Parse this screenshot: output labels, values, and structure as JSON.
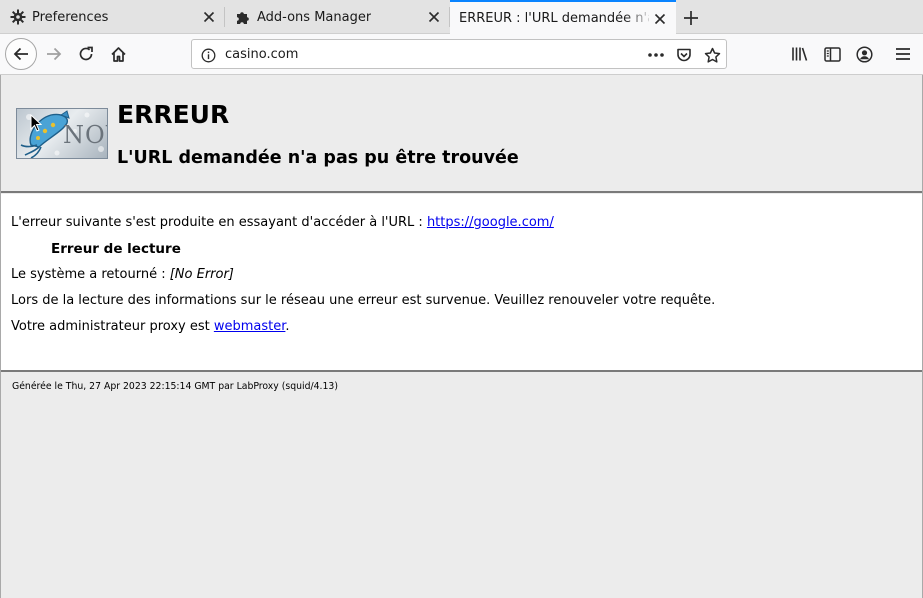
{
  "tabs": [
    {
      "label": "Preferences",
      "icon": "gear-icon"
    },
    {
      "label": "Add-ons Manager",
      "icon": "puzzle-icon"
    },
    {
      "label": "ERREUR : l'URL demandée n'a pas pu être trouvée",
      "icon": "none",
      "active": true
    }
  ],
  "url": "casino.com",
  "header": {
    "logo_text": "NOW",
    "title": "ERREUR",
    "subtitle": "L'URL demandée n'a pas pu être trouvée"
  },
  "body": {
    "line1_prefix": "L'erreur suivante s'est produite en essayant d'accéder à l'URL : ",
    "line1_link": "https://google.com/",
    "error_name": "Erreur de lecture",
    "line3_prefix": "Le système a retourné : ",
    "line3_value": "[No Error]",
    "line4": "Lors de la lecture des informations sur le réseau une erreur est survenue. Veuillez renouveler votre requête.",
    "line5_prefix": "Votre administrateur proxy est ",
    "line5_link": "webmaster",
    "line5_suffix": "."
  },
  "footer": "Générée le Thu, 27 Apr 2023 22:15:14 GMT par LabProxy (squid/4.13)",
  "colors": {
    "accent": "#0a84ff",
    "link": "#0000ee"
  }
}
